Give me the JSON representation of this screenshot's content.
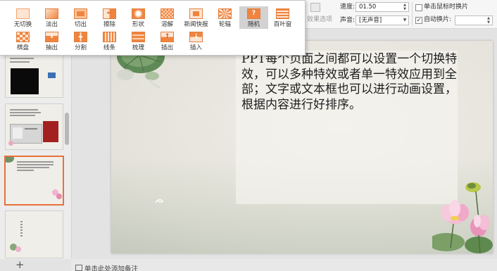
{
  "ribbon": {
    "effect_options_label": "效果选项",
    "speed_label": "速度:",
    "speed_value": "01.50",
    "sound_label": "声音:",
    "sound_value": "[无声音]",
    "advance_on_click_label": "单击鼠标时换片",
    "advance_on_click_checked": false,
    "auto_advance_label": "自动换片:",
    "auto_advance_checked": true
  },
  "transition_panel": {
    "selected": "随机",
    "row1": [
      {
        "label": "无切换",
        "icon": "no-transition-icon"
      },
      {
        "label": "淡出",
        "icon": "fade-icon"
      },
      {
        "label": "切出",
        "icon": "cut-icon"
      },
      {
        "label": "擦除",
        "icon": "wipe-icon"
      },
      {
        "label": "形状",
        "icon": "shape-icon"
      },
      {
        "label": "溶解",
        "icon": "dissolve-icon"
      },
      {
        "label": "新闻快报",
        "icon": "newsflash-icon"
      },
      {
        "label": "轮辐",
        "icon": "wheel-icon"
      },
      {
        "label": "随机",
        "icon": "random-icon"
      },
      {
        "label": "百叶窗",
        "icon": "blinds-icon"
      }
    ],
    "row2": [
      {
        "label": "棋盘",
        "icon": "checkerboard-icon"
      },
      {
        "label": "抽出",
        "icon": "pull-icon"
      },
      {
        "label": "分割",
        "icon": "split-icon"
      },
      {
        "label": "线条",
        "icon": "lines-icon"
      },
      {
        "label": "梳理",
        "icon": "comb-icon"
      },
      {
        "label": "插出",
        "icon": "push-icon"
      },
      {
        "label": "插入",
        "icon": "cover-icon"
      }
    ]
  },
  "slide": {
    "body_lines": [
      "PPT每个页面之间都可以设置一个切换特",
      "效，可以多种特效或者单一特效应用到全",
      "部；文字或文本框也可以进行动画设置，",
      "根据内容进行好排序。"
    ]
  },
  "notes": {
    "placeholder": "单击此处添加备注"
  },
  "sidebar": {
    "add_slide_label": "+"
  },
  "colors": {
    "accent": "#f0843f",
    "selection_border": "#e8713a",
    "workspace": "#e3e3e3"
  }
}
